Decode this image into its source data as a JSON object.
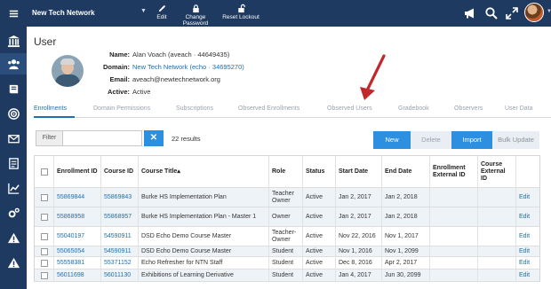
{
  "header": {
    "org_name": "New Tech Network",
    "tools": [
      {
        "label": "Edit",
        "icon": "edit-icon"
      },
      {
        "label": "Change Password",
        "icon": "lock-icon"
      },
      {
        "label": "Reset Lockout",
        "icon": "unlock-icon"
      }
    ],
    "right_icons": [
      "megaphone-icon",
      "search-icon",
      "expand-icon"
    ]
  },
  "sidebar": {
    "items": [
      "menu-icon",
      "institution-icon",
      "users-icon",
      "book-icon",
      "target-icon",
      "mail-icon",
      "report-icon",
      "chart-icon",
      "settings-icon",
      "alert-icon",
      "warning-icon"
    ]
  },
  "page": {
    "title": "User"
  },
  "user": {
    "name_label": "Name:",
    "name": "Alan Voach (aveach · 44649435)",
    "domain_label": "Domain:",
    "domain": "New Tech Network (echo · 34695270)",
    "email_label": "Email:",
    "email": "aveach@newtechnetwork.org",
    "active_label": "Active:",
    "active": "Active"
  },
  "tabs": [
    "Enrollments",
    "Domain Permissions",
    "Subscriptions",
    "Observed Enrollments",
    "Observed Users",
    "Gradebook",
    "Observers",
    "User Data"
  ],
  "filter": {
    "label": "Filter",
    "value": "",
    "clear": "✕",
    "results": "22 results"
  },
  "actions": {
    "new": "New",
    "delete": "Delete",
    "import": "Import",
    "bulk": "Bulk Update"
  },
  "table": {
    "headers": [
      "Enrollment ID",
      "Course ID",
      "Course Title▴",
      "Role",
      "Status",
      "Start Date",
      "End Date",
      "Enrollment External ID",
      "Course External ID",
      ""
    ],
    "rows": [
      [
        "55869844",
        "55869843",
        "Burke HS Implementation Plan",
        "Teacher Owner",
        "Active",
        "Jan 2, 2017",
        "Jan 2, 2018",
        "",
        "",
        "Edit"
      ],
      [
        "55868958",
        "55868957",
        "Burke HS Implementation Plan - Master 1",
        "Owner",
        "Active",
        "Jan 2, 2017",
        "Jan 2, 2018",
        "",
        "",
        "Edit"
      ],
      [
        "55040197",
        "54590911",
        "DSD Echo Demo Course Master",
        "Teacher-Owner",
        "Active",
        "Nov 22, 2016",
        "Nov 1, 2017",
        "",
        "",
        "Edit"
      ],
      [
        "55065054",
        "54590911",
        "DSD Echo Demo Course Master",
        "Student",
        "Active",
        "Nov 1, 2016",
        "Nov 1, 2099",
        "",
        "",
        "Edit"
      ],
      [
        "55558381",
        "55371152",
        "Echo Refresher for NTN Staff",
        "Student",
        "Active",
        "Dec 8, 2016",
        "Apr 2, 2017",
        "",
        "",
        "Edit"
      ],
      [
        "56011698",
        "56011130",
        "Exhibitions of Learning Derivative",
        "Student",
        "Active",
        "Jan 4, 2017",
        "Jun 30, 2099",
        "",
        "",
        "Edit"
      ]
    ]
  },
  "colors": {
    "nav": "#1f3a60",
    "accent": "#2d8fe0",
    "link": "#1a6fb5",
    "annotation": "#c0282d"
  }
}
